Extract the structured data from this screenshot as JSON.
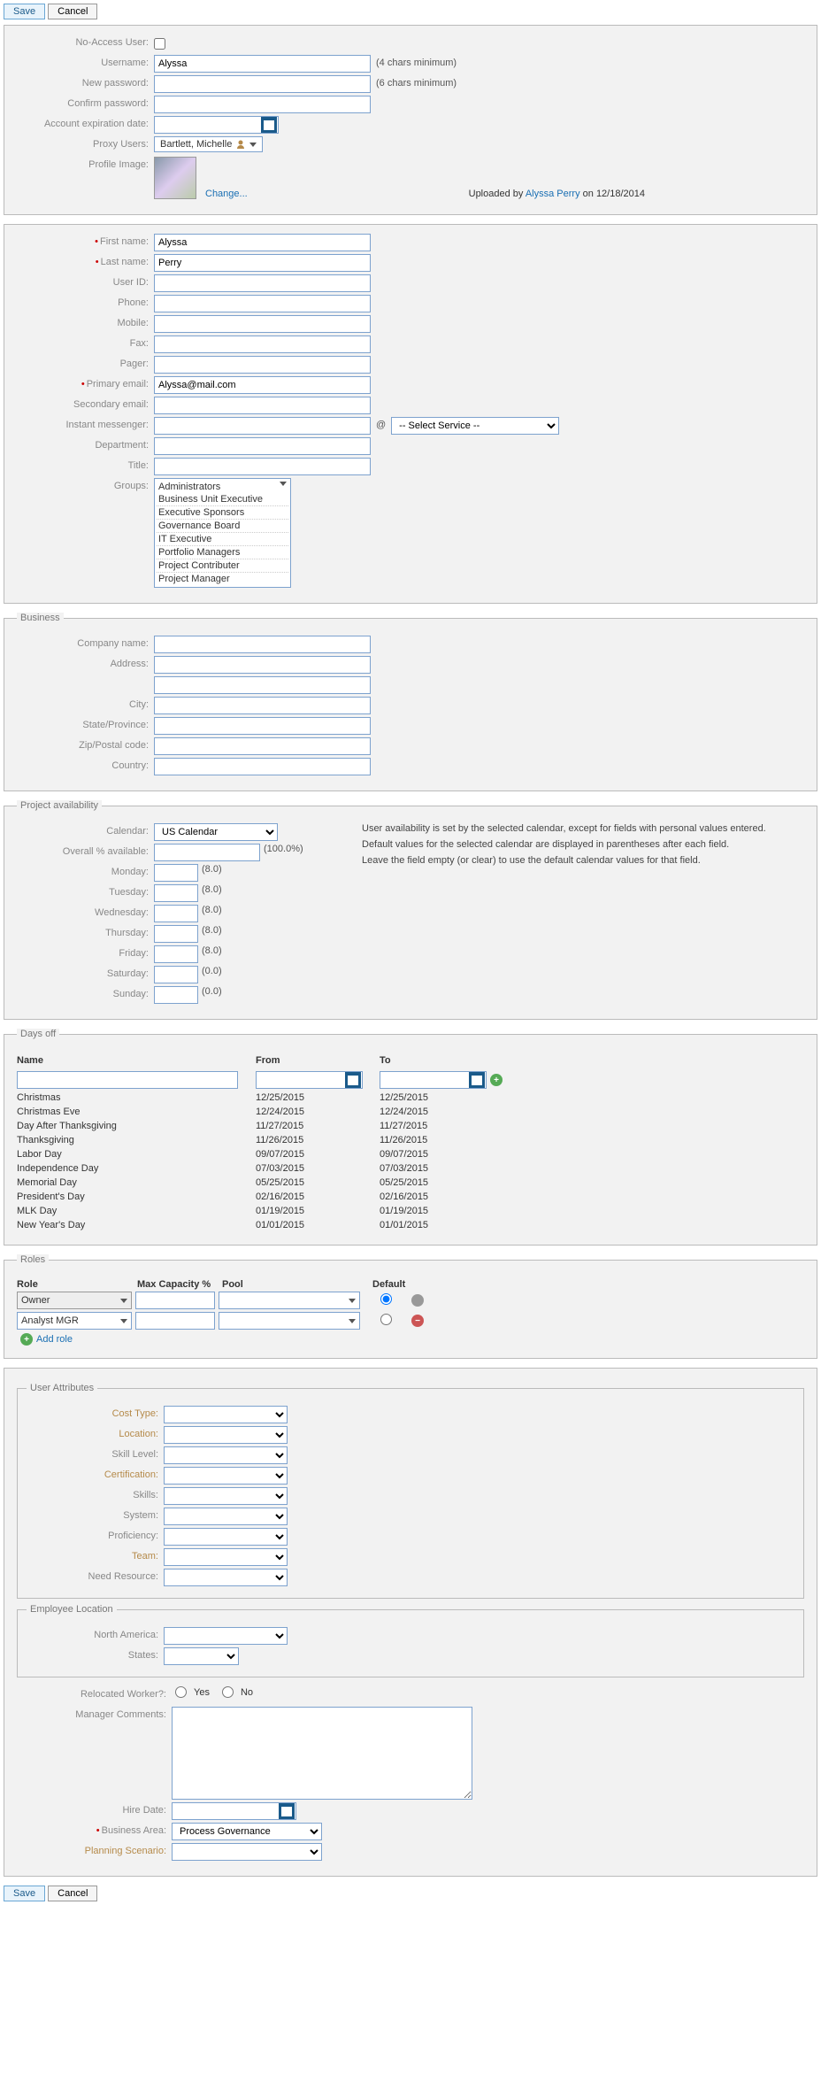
{
  "buttons": {
    "save": "Save",
    "cancel": "Cancel"
  },
  "access": {
    "labels": {
      "noaccess": "No-Access User:",
      "username": "Username:",
      "newpass": "New password:",
      "confirm": "Confirm password:",
      "expiry": "Account expiration date:",
      "proxy": "Proxy Users:",
      "profile": "Profile Image:"
    },
    "username": "Alyssa",
    "username_hint": "(4 chars minimum)",
    "password_hint": "(6 chars minimum)",
    "proxy_user": "Bartlett, Michelle",
    "change_link": "Change...",
    "uploaded_prefix": "Uploaded by ",
    "uploaded_user": "Alyssa Perry",
    "uploaded_suffix": " on 12/18/2014"
  },
  "identity": {
    "labels": {
      "first": "First name:",
      "last": "Last name:",
      "uid": "User ID:",
      "phone": "Phone:",
      "mobile": "Mobile:",
      "fax": "Fax:",
      "pager": "Pager:",
      "pemail": "Primary email:",
      "semail": "Secondary email:",
      "im": "Instant messenger:",
      "dept": "Department:",
      "title": "Title:",
      "groups": "Groups:"
    },
    "first": "Alyssa",
    "last": "Perry",
    "pemail": "Alyssa@mail.com",
    "im_at": "@",
    "im_service": "-- Select Service --",
    "groups_header": "Administrators",
    "groups": [
      "Business Unit Executive",
      "Executive Sponsors",
      "Governance Board",
      "IT Executive",
      "Portfolio Managers",
      "Project Contributer",
      "Project Manager"
    ]
  },
  "business": {
    "legend": "Business",
    "labels": {
      "company": "Company name:",
      "address": "Address:",
      "city": "City:",
      "state": "State/Province:",
      "zip": "Zip/Postal code:",
      "country": "Country:"
    }
  },
  "availability": {
    "legend": "Project availability",
    "labels": {
      "cal": "Calendar:",
      "overall": "Overall % available:",
      "mon": "Monday:",
      "tue": "Tuesday:",
      "wed": "Wednesday:",
      "thu": "Thursday:",
      "fri": "Friday:",
      "sat": "Saturday:",
      "sun": "Sunday:"
    },
    "calendar": "US Calendar",
    "overall_paren": "(100.0%)",
    "defaults": {
      "mon": "(8.0)",
      "tue": "(8.0)",
      "wed": "(8.0)",
      "thu": "(8.0)",
      "fri": "(8.0)",
      "sat": "(0.0)",
      "sun": "(0.0)"
    },
    "help1": "User availability is set by the selected calendar, except for fields with personal values entered.",
    "help2": "Default values for the selected calendar are displayed in parentheses after each field.",
    "help3": "Leave the field empty (or clear) to use the default calendar values for that field."
  },
  "daysoff": {
    "legend": "Days off",
    "headers": {
      "name": "Name",
      "from": "From",
      "to": "To"
    },
    "rows": [
      {
        "name": "Christmas",
        "from": "12/25/2015",
        "to": "12/25/2015"
      },
      {
        "name": "Christmas Eve",
        "from": "12/24/2015",
        "to": "12/24/2015"
      },
      {
        "name": "Day After Thanksgiving",
        "from": "11/27/2015",
        "to": "11/27/2015"
      },
      {
        "name": "Thanksgiving",
        "from": "11/26/2015",
        "to": "11/26/2015"
      },
      {
        "name": "Labor Day",
        "from": "09/07/2015",
        "to": "09/07/2015"
      },
      {
        "name": "Independence Day",
        "from": "07/03/2015",
        "to": "07/03/2015"
      },
      {
        "name": "Memorial Day",
        "from": "05/25/2015",
        "to": "05/25/2015"
      },
      {
        "name": "President's Day",
        "from": "02/16/2015",
        "to": "02/16/2015"
      },
      {
        "name": "MLK Day",
        "from": "01/19/2015",
        "to": "01/19/2015"
      },
      {
        "name": "New Year's Day",
        "from": "01/01/2015",
        "to": "01/01/2015"
      }
    ]
  },
  "roles": {
    "legend": "Roles",
    "headers": {
      "role": "Role",
      "cap": "Max Capacity %",
      "pool": "Pool",
      "def": "Default"
    },
    "rows": [
      {
        "role": "Owner",
        "cap": "",
        "pool": "",
        "default": true,
        "removable": false
      },
      {
        "role": "Analyst MGR",
        "cap": "",
        "pool": "",
        "default": false,
        "removable": true
      }
    ],
    "add_label": "Add role"
  },
  "attrs": {
    "legend": "User Attributes",
    "labels": {
      "cost": "Cost Type:",
      "loc": "Location:",
      "skill": "Skill Level:",
      "cert": "Certification:",
      "skills": "Skills:",
      "system": "System:",
      "prof": "Proficiency:",
      "team": "Team:",
      "need": "Need Resource:"
    }
  },
  "emploc": {
    "legend": "Employee Location",
    "labels": {
      "na": "North America:",
      "states": "States:"
    }
  },
  "footer": {
    "labels": {
      "reloc": "Relocated Worker?:",
      "yes": "Yes",
      "no": "No",
      "mgr": "Manager Comments:",
      "hire": "Hire Date:",
      "ba": "Business Area:",
      "plan": "Planning Scenario:"
    },
    "business_area": "Process Governance"
  }
}
